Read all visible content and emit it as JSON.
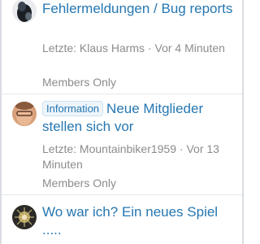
{
  "threads": [
    {
      "title": "Fehlermeldungen / Bug reports",
      "label": "",
      "meta_prefix": "Letzte: ",
      "user": "Klaus Harms",
      "separator": " · ",
      "time": "Vor 4 Minuten",
      "access": "Members Only"
    },
    {
      "title": "Neue Mitglieder stellen sich vor",
      "label": "Information",
      "meta_prefix": "Letzte: ",
      "user": "Mountainbiker1959",
      "separator": " · ",
      "time": "Vor 13 Minuten",
      "access": "Members Only"
    },
    {
      "title": "Wo war ich? Ein neues Spiel .....",
      "label": "",
      "meta_prefix": "",
      "user": "",
      "separator": "",
      "time": "",
      "access": ""
    }
  ],
  "colors": {
    "link": "#2577b1",
    "muted": "#8c8c8c",
    "label_bg": "#edf5fb"
  }
}
